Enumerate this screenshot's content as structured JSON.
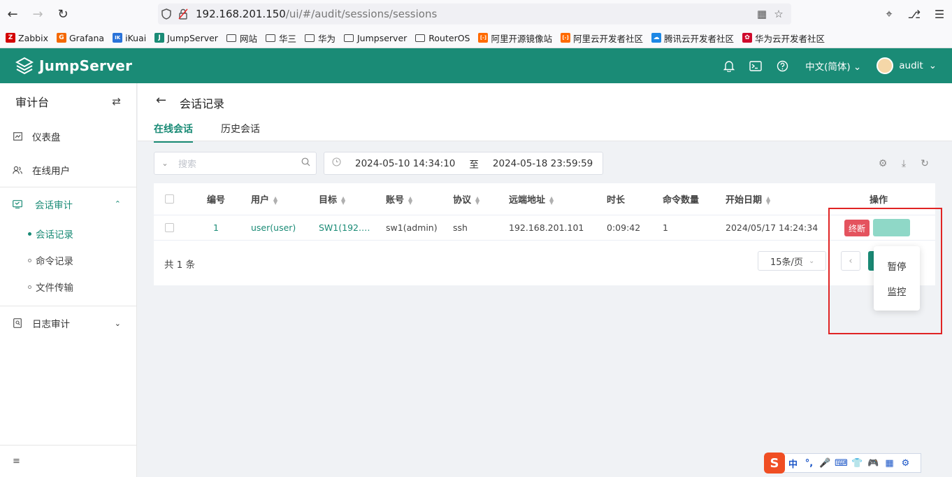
{
  "browser": {
    "url_host": "192.168.201.150",
    "url_path": "/ui/#/audit/sessions/sessions"
  },
  "bookmarks": [
    {
      "label": "Zabbix",
      "icon": "zabbix-icon",
      "color": "#d40000",
      "glyph": "Z"
    },
    {
      "label": "Grafana",
      "icon": "grafana-icon",
      "color": "#f46800",
      "glyph": "G"
    },
    {
      "label": "iKuai",
      "icon": "ikuai-icon",
      "color": "#2a73d9",
      "glyph": "IK"
    },
    {
      "label": "JumpServer",
      "icon": "jumpserver-icon",
      "color": "#1a8b76",
      "glyph": "J"
    },
    {
      "label": "网站",
      "icon": "folder-icon"
    },
    {
      "label": "华三",
      "icon": "folder-icon"
    },
    {
      "label": "华为",
      "icon": "folder-icon"
    },
    {
      "label": "Jumpserver",
      "icon": "folder-icon"
    },
    {
      "label": "RouterOS",
      "icon": "folder-icon"
    },
    {
      "label": "阿里开源镜像站",
      "icon": "aliyun-icon",
      "color": "#ff6a00",
      "glyph": "[-]"
    },
    {
      "label": "阿里云开发者社区",
      "icon": "aliyun-icon",
      "color": "#ff6a00",
      "glyph": "[-]"
    },
    {
      "label": "腾讯云开发者社区",
      "icon": "tencent-cloud-icon",
      "color": "#1e88e5",
      "glyph": "☁"
    },
    {
      "label": "华为云开发者社区",
      "icon": "huawei-icon",
      "color": "#cf0a2c",
      "glyph": "✿"
    }
  ],
  "header": {
    "brand": "JumpServer",
    "language": "中文(简体)",
    "username": "audit",
    "brand_color": "#1a8b76"
  },
  "sidebar": {
    "title": "审计台",
    "items": [
      {
        "label": "仪表盘",
        "icon": "dashboard-icon"
      },
      {
        "label": "在线用户",
        "icon": "users-icon"
      },
      {
        "label": "会话审计",
        "icon": "session-audit-icon"
      },
      {
        "label": "日志审计",
        "icon": "log-audit-icon"
      }
    ],
    "sub_items": [
      {
        "label": "会话记录"
      },
      {
        "label": "命令记录"
      },
      {
        "label": "文件传输"
      }
    ]
  },
  "page": {
    "title": "会话记录",
    "tabs": [
      {
        "label": "在线会话"
      },
      {
        "label": "历史会话"
      }
    ],
    "search_placeholder": "搜索",
    "date_from": "2024-05-10 14:34:10",
    "date_sep": "至",
    "date_to": "2024-05-18 23:59:59"
  },
  "table": {
    "headers": [
      "编号",
      "用户",
      "目标",
      "账号",
      "协议",
      "远端地址",
      "时长",
      "命令数量",
      "开始日期",
      "操作"
    ],
    "rows": [
      {
        "id": "1",
        "user": "user(user)",
        "target": "SW1(192.…",
        "account": "sw1(admin)",
        "protocol": "ssh",
        "remote_addr": "192.168.201.101",
        "duration": "0:09:42",
        "command_count": "1",
        "start_date": "2024/05/17 14:24:34",
        "terminate_label": "终断"
      }
    ],
    "total": "共 1 条",
    "page_size": "15条/页"
  },
  "dropdown": {
    "items": [
      {
        "label": "暂停"
      },
      {
        "label": "监控"
      }
    ]
  },
  "ime": {
    "logo": "S",
    "mode": "中"
  }
}
